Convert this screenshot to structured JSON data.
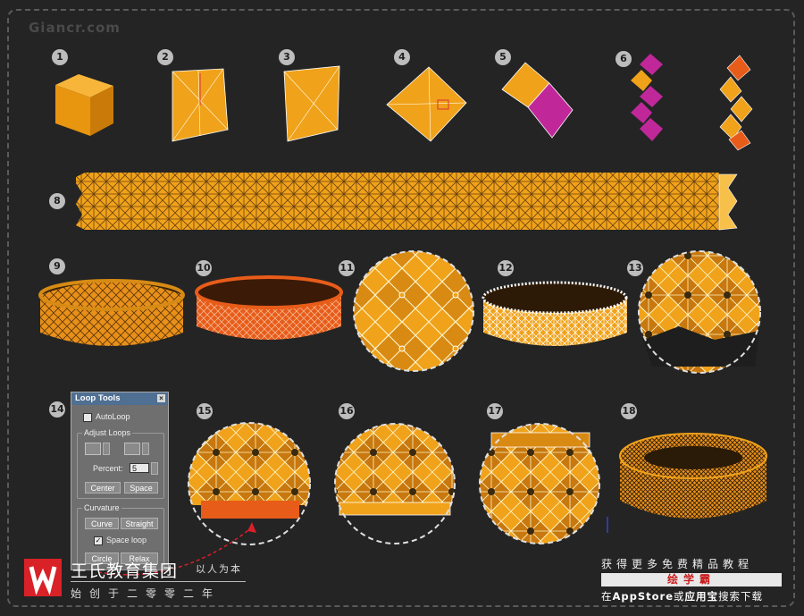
{
  "watermark": "Giancr.com",
  "steps": [
    "1",
    "2",
    "3",
    "4",
    "5",
    "6",
    "8",
    "9",
    "10",
    "11",
    "12",
    "13",
    "14",
    "15",
    "16",
    "17",
    "18"
  ],
  "loop_tools": {
    "title": "Loop Tools",
    "close": "×",
    "autoloop": "AutoLoop",
    "adjust_loops": "Adjust Loops",
    "percent_label": "Percent:",
    "percent_value": "5",
    "center": "Center",
    "space": "Space",
    "curvature": "Curvature",
    "curve": "Curve",
    "straight": "Straight",
    "space_loop": "Space loop",
    "circle": "Circle",
    "relax": "Relax"
  },
  "footer": {
    "brand": "王氏教育集团",
    "motto": "以人为本",
    "since": "始创于二零零二年",
    "promo_line1": "获得更多免费精品教程",
    "promo_line2": "绘学霸",
    "promo_prefix": "在",
    "promo_store1": "AppStore",
    "promo_or": "或",
    "promo_store2": "应用宝",
    "promo_suffix": "搜索下载"
  },
  "colors": {
    "orange": "#f0a21a",
    "magenta": "#c0289a",
    "background": "#242424",
    "logo_red": "#d92128"
  }
}
